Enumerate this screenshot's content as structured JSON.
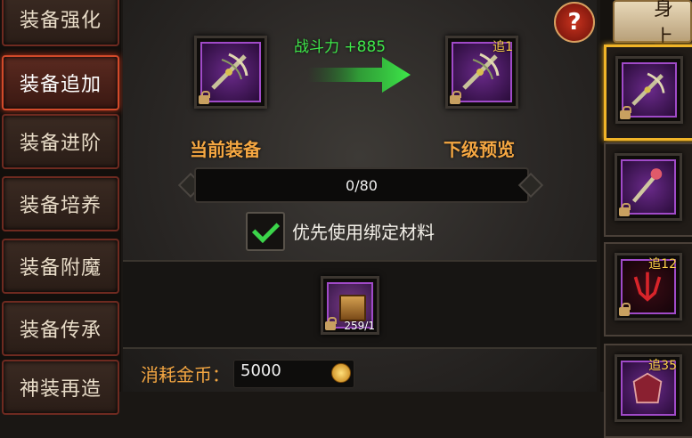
{
  "sidebar": {
    "tabs": [
      {
        "label": "装备强化",
        "active": false
      },
      {
        "label": "装备追加",
        "active": true
      },
      {
        "label": "装备进阶",
        "active": false
      },
      {
        "label": "装备培养",
        "active": false
      },
      {
        "label": "装备附魔",
        "active": false
      },
      {
        "label": "装备传承",
        "active": false
      },
      {
        "label": "神装再造",
        "active": false
      }
    ]
  },
  "main": {
    "help_label": "?",
    "power_text": "战斗力 +885",
    "current_label": "当前装备",
    "next_label": "下级预览",
    "next_tag": "追1",
    "progress_text": "0/80",
    "progress_value": 0,
    "progress_max": 80,
    "checkbox_checked": true,
    "checkbox_label": "优先使用绑定材料",
    "material_count": "259/1",
    "cost_label": "消耗金币：",
    "cost_value": "5000"
  },
  "right": {
    "tab_label": "身上",
    "items": [
      {
        "tag": "",
        "selected": true
      },
      {
        "tag": "",
        "selected": false
      },
      {
        "tag": "追12",
        "selected": false
      },
      {
        "tag": "追35",
        "selected": false
      }
    ]
  },
  "colors": {
    "accent_orange": "#f5a742",
    "power_green": "#3ee84a",
    "tag_yellow": "#ffd24a",
    "active_tab_red": "#d24a2a"
  }
}
